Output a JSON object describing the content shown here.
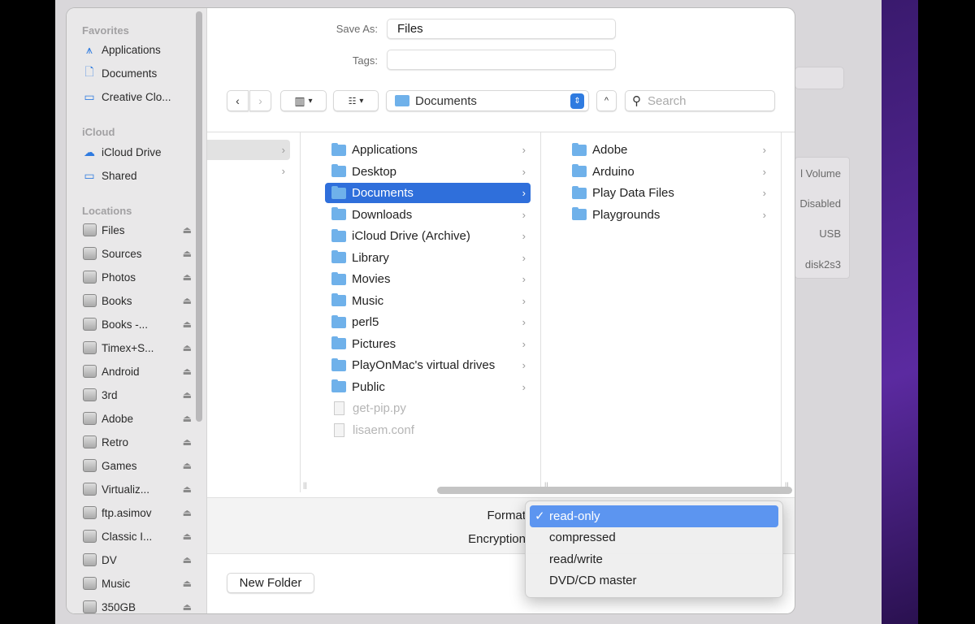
{
  "background": {
    "info": [
      "l Volume",
      "Disabled",
      "USB",
      "disk2s3"
    ]
  },
  "sidebar": {
    "favorites_header": "Favorites",
    "favorites": [
      {
        "label": "Applications",
        "icon": "app-store-icon"
      },
      {
        "label": "Documents",
        "icon": "document-icon"
      },
      {
        "label": "Creative Clo...",
        "icon": "folder-icon"
      }
    ],
    "icloud_header": "iCloud",
    "icloud": [
      {
        "label": "iCloud Drive",
        "icon": "cloud-icon"
      },
      {
        "label": "Shared",
        "icon": "shared-folder-icon"
      }
    ],
    "locations_header": "Locations",
    "locations": [
      "Files",
      "Sources",
      "Photos",
      "Books",
      "Books -...",
      "Timex+S...",
      "Android",
      "3rd",
      "Adobe",
      "Retro",
      "Games",
      "Virtualiz...",
      "ftp.asimov",
      "Classic I...",
      "DV",
      "Music",
      "350GB"
    ]
  },
  "save_as": {
    "label": "Save As:",
    "value": "Files"
  },
  "tags": {
    "label": "Tags:",
    "value": ""
  },
  "toolbar": {
    "location": "Documents",
    "search_placeholder": "Search"
  },
  "columns": {
    "col2": [
      {
        "name": "Applications",
        "folder": true
      },
      {
        "name": "Desktop",
        "folder": true
      },
      {
        "name": "Documents",
        "folder": true,
        "selected": true
      },
      {
        "name": "Downloads",
        "folder": true
      },
      {
        "name": "iCloud Drive (Archive)",
        "folder": true
      },
      {
        "name": "Library",
        "folder": true
      },
      {
        "name": "Movies",
        "folder": true
      },
      {
        "name": "Music",
        "folder": true
      },
      {
        "name": "perl5",
        "folder": true
      },
      {
        "name": "Pictures",
        "folder": true
      },
      {
        "name": "PlayOnMac's virtual drives",
        "folder": true
      },
      {
        "name": "Public",
        "folder": true
      },
      {
        "name": "get-pip.py",
        "folder": false
      },
      {
        "name": "lisaem.conf",
        "folder": false
      }
    ],
    "col3": [
      "Adobe",
      "Arduino",
      "Play Data Files",
      "Playgrounds"
    ]
  },
  "options": {
    "format_label": "Format",
    "encryption_label": "Encryption"
  },
  "format_menu": {
    "items": [
      "read-only",
      "compressed",
      "read/write",
      "DVD/CD master"
    ],
    "selected": "read-only",
    "check": "✓"
  },
  "new_folder": "New Folder",
  "colors": {
    "accent": "#2f6fdb",
    "menu_highlight": "#5c95f0",
    "folder": "#6fb1ea"
  }
}
